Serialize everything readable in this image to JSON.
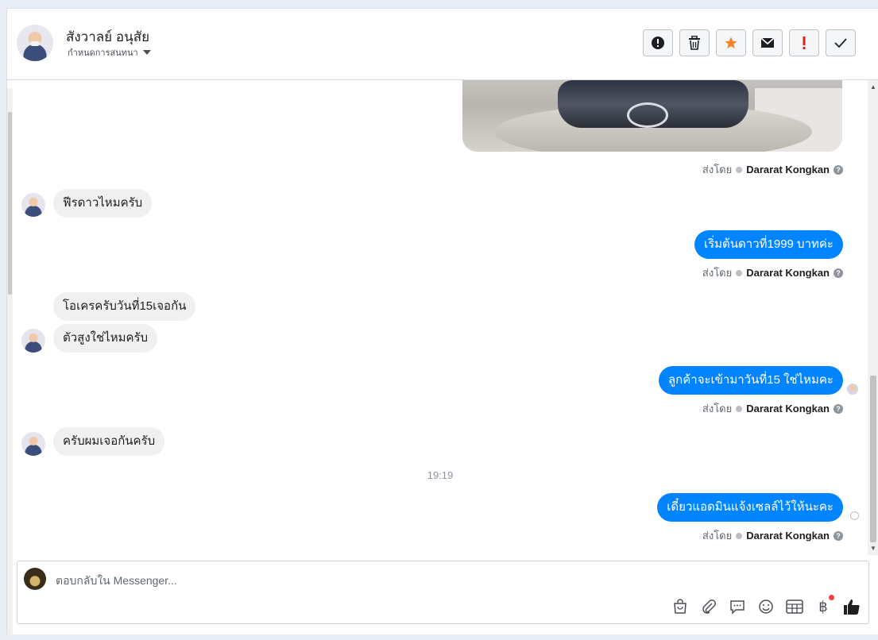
{
  "header": {
    "contact_name": "สังวาลย์ อนุสัย",
    "subtitle": "กำหนดการสนทนา",
    "actions": [
      {
        "name": "report-button",
        "icon": "alert-circle-icon"
      },
      {
        "name": "delete-button",
        "icon": "trash-icon"
      },
      {
        "name": "star-button",
        "icon": "star-icon",
        "color": "#f0852d"
      },
      {
        "name": "mark-unread-button",
        "icon": "envelope-icon"
      },
      {
        "name": "spam-button",
        "icon": "exclamation-icon",
        "color": "#e02020"
      },
      {
        "name": "mark-done-button",
        "icon": "check-icon"
      }
    ]
  },
  "messages": {
    "sent_label": "ส่งโดย",
    "agent": "Dararat Kongkan",
    "m1": "ฟีรดาวไหมครับ",
    "m2": "เริ่มต้นดาวที่1999 บาทค่ะ",
    "m3": "โอเครครับวันที่15เจอกัน",
    "m4": "ตัวสูงใช่ไหมครับ",
    "m5": "ลูกค้าจะเข้ามาวันที่15 ใช่ไหมคะ",
    "m6": "ครับผมเจอกันครับ",
    "time": "19:19",
    "m7": "เดี๋ยวแอดมินแจ้งเซลล์ไว้ให้นะคะ"
  },
  "composer": {
    "placeholder": "ตอบกลับใน Messenger...",
    "value": "",
    "tools": [
      "shopping-bag-icon",
      "paperclip-icon",
      "quick-reply-icon",
      "emoji-icon",
      "table-icon",
      "baht-icon",
      "thumbs-up-icon"
    ],
    "baht_symbol": "฿"
  },
  "colors": {
    "outgoing_bubble": "#0084ff",
    "incoming_bubble": "#f0f0f0",
    "star": "#f0852d",
    "spam": "#e02020"
  }
}
